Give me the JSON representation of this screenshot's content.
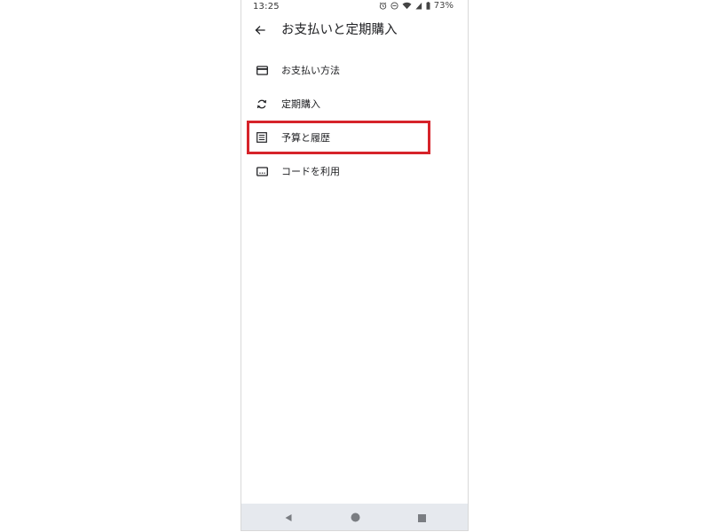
{
  "status_bar": {
    "time": "13:25",
    "battery": "73%",
    "icons": [
      "alarm-icon",
      "do-not-disturb-icon",
      "wifi-icon",
      "signal-icon",
      "battery-icon"
    ]
  },
  "app_bar": {
    "title": "お支払いと定期購入",
    "back_icon": "arrow-back-icon"
  },
  "menu": {
    "items": [
      {
        "label": "お支払い方法",
        "icon": "credit-card-icon"
      },
      {
        "label": "定期購入",
        "icon": "sync-icon"
      },
      {
        "label": "予算と履歴",
        "icon": "list-document-icon",
        "highlighted": true
      },
      {
        "label": "コードを利用",
        "icon": "redeem-code-icon"
      }
    ]
  },
  "highlight_color": "#d6232a",
  "nav_bar": {
    "buttons": [
      "back-triangle-icon",
      "home-circle-icon",
      "recents-square-icon"
    ],
    "background": "#e6e9ee"
  }
}
